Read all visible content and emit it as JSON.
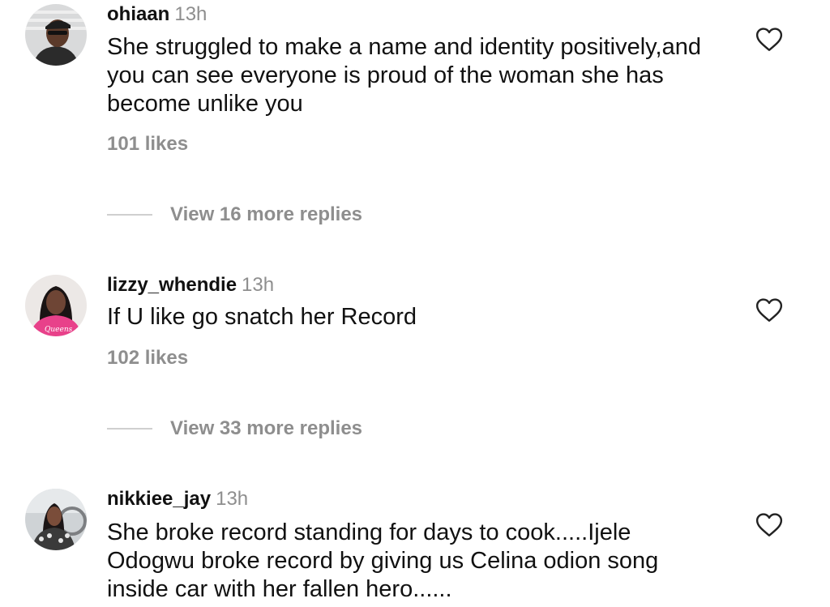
{
  "comments": [
    {
      "username": "ohiaan",
      "time": "13h",
      "text": "She struggled to make a name and identity positively,and you can see everyone is proud of the woman she has become unlike you",
      "likes": "101 likes",
      "replies": "View 16 more replies",
      "avatar_icon": "avatar-man-cap"
    },
    {
      "username": "lizzy_whendie",
      "time": "13h",
      "text": "If U like go snatch her Record",
      "likes": "102 likes",
      "replies": "View 33 more replies",
      "avatar_icon": "avatar-woman-pink"
    },
    {
      "username": "nikkiee_jay",
      "time": "13h",
      "text": "She broke record standing for days to cook.....Ijele Odogwu broke record by giving us Celina odion song inside car with her fallen hero......",
      "avatar_icon": "avatar-woman-car"
    }
  ],
  "icons": {
    "like": "heart-outline-icon"
  },
  "colors": {
    "text": "#111111",
    "muted": "#8e8e8e",
    "divider": "#cfcfcf",
    "background": "#ffffff"
  }
}
